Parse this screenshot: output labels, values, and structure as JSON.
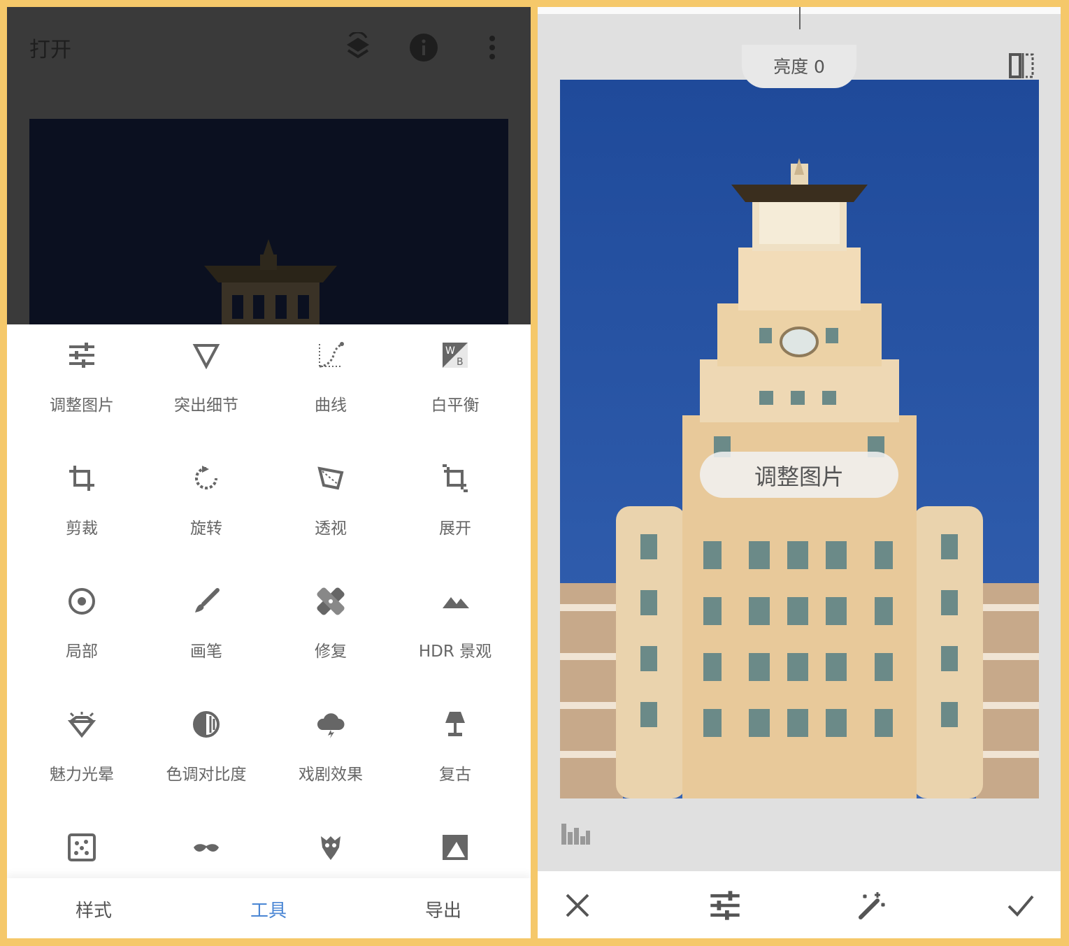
{
  "left_panel": {
    "header": {
      "title": "打开",
      "icons": [
        "layers-undo-icon",
        "info-icon",
        "more-vert-icon"
      ]
    },
    "tools": [
      {
        "label": "调整图片",
        "icon": "tune-icon"
      },
      {
        "label": "突出细节",
        "icon": "details-triangle-icon"
      },
      {
        "label": "曲线",
        "icon": "curves-icon"
      },
      {
        "label": "白平衡",
        "icon": "white-balance-icon"
      },
      {
        "label": "剪裁",
        "icon": "crop-icon"
      },
      {
        "label": "旋转",
        "icon": "rotate-icon"
      },
      {
        "label": "透视",
        "icon": "perspective-icon"
      },
      {
        "label": "展开",
        "icon": "expand-icon"
      },
      {
        "label": "局部",
        "icon": "selective-icon"
      },
      {
        "label": "画笔",
        "icon": "brush-icon"
      },
      {
        "label": "修复",
        "icon": "healing-icon"
      },
      {
        "label": "HDR 景观",
        "icon": "hdr-landscape-icon"
      },
      {
        "label": "魅力光晕",
        "icon": "glamour-glow-icon"
      },
      {
        "label": "色调对比度",
        "icon": "tonal-contrast-icon"
      },
      {
        "label": "戏剧效果",
        "icon": "drama-icon"
      },
      {
        "label": "复古",
        "icon": "vintage-lamp-icon"
      },
      {
        "label": "",
        "icon": "grainy-film-icon"
      },
      {
        "label": "",
        "icon": "mustache-icon"
      },
      {
        "label": "",
        "icon": "grunge-icon"
      },
      {
        "label": "",
        "icon": "black-white-icon"
      }
    ],
    "bottom_nav": {
      "styles": "样式",
      "tools": "工具",
      "export": "导出",
      "active_color": "#4a86d4"
    }
  },
  "right_panel": {
    "brightness_label": "亮度 0",
    "adjust_label": "调整图片",
    "icons": [
      "compare-icon",
      "histogram-icon",
      "cancel-icon",
      "tune-icon",
      "auto-magic-icon",
      "apply-check-icon"
    ]
  },
  "colors": {
    "frame": "#f5c86a",
    "sky": "#2b54a3",
    "accent": "#4a86d4"
  }
}
